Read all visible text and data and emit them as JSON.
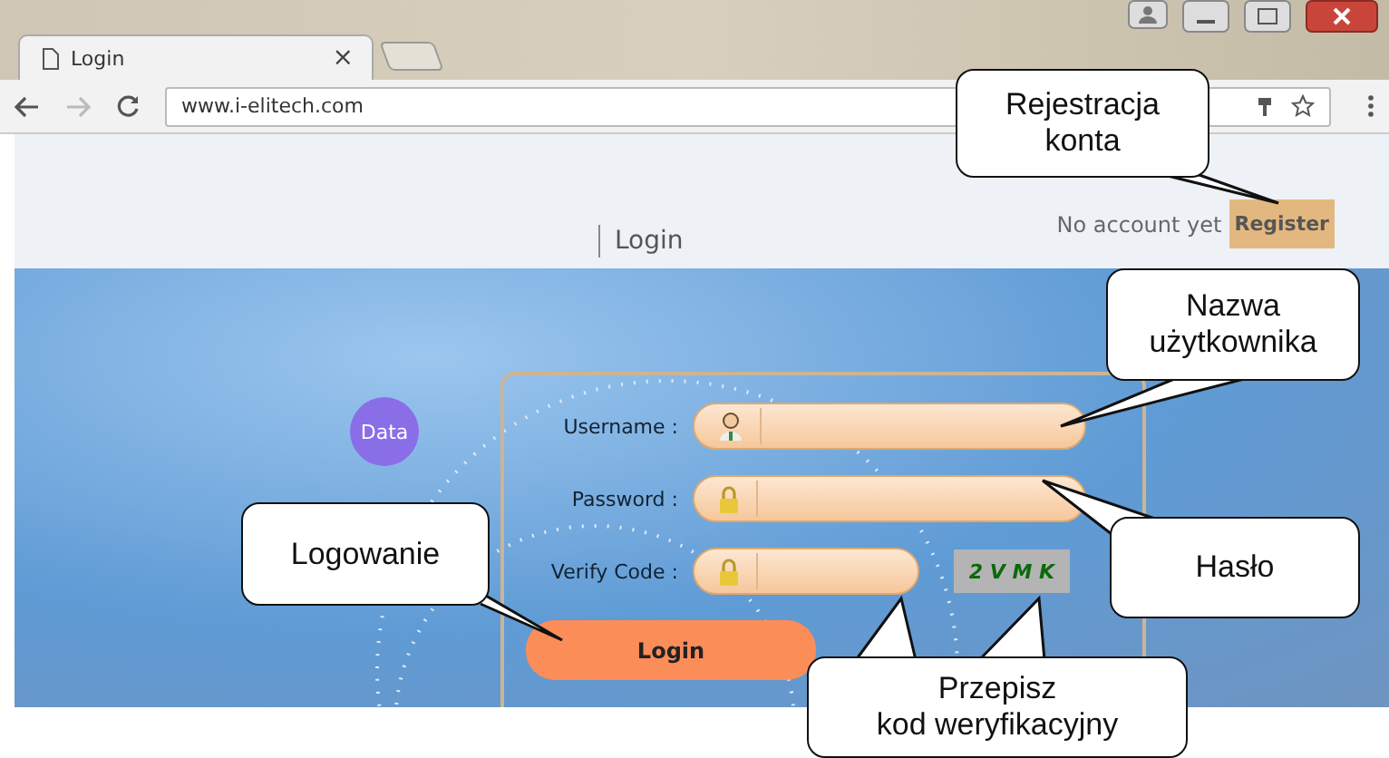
{
  "browser": {
    "tab": {
      "title": "Login",
      "close": "×"
    },
    "address": "www.i-elitech.com"
  },
  "header": {
    "title": "Login",
    "prompt": "No account yet",
    "register": "Register"
  },
  "form": {
    "badge": "Data",
    "fields": [
      {
        "label": "Username :",
        "kind": "user"
      },
      {
        "label": "Password :",
        "kind": "lock"
      },
      {
        "label": "Verify Code :",
        "kind": "lock"
      }
    ],
    "captcha": "2 V M K",
    "submit": "Login"
  },
  "callouts": [
    {
      "lines": [
        "Rejestracja",
        "konta"
      ]
    },
    {
      "lines": [
        "Nazwa",
        "użytkownika"
      ]
    },
    {
      "lines": [
        "Hasło"
      ]
    },
    {
      "lines": [
        "Logowanie"
      ]
    },
    {
      "lines": [
        "Przepisz",
        "kod weryfikacyjny"
      ]
    }
  ]
}
